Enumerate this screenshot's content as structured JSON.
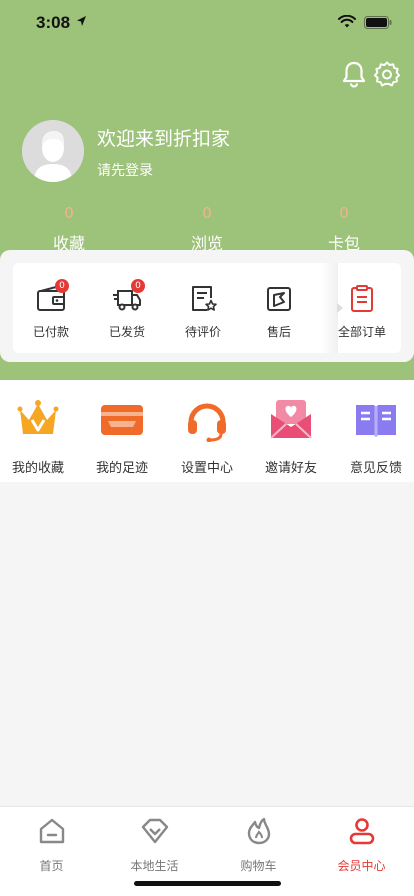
{
  "status": {
    "time": "3:08"
  },
  "profile": {
    "welcome": "欢迎来到折扣家",
    "login": "请先登录"
  },
  "stats": [
    {
      "count": "0",
      "label": "收藏"
    },
    {
      "count": "0",
      "label": "浏览"
    },
    {
      "count": "0",
      "label": "卡包"
    }
  ],
  "orders": {
    "items": [
      {
        "label": "已付款",
        "badge": "0",
        "icon": "wallet-icon"
      },
      {
        "label": "已发货",
        "badge": "0",
        "icon": "truck-icon"
      },
      {
        "label": "待评价",
        "icon": "review-icon"
      },
      {
        "label": "售后",
        "icon": "after-sales-icon"
      }
    ],
    "all": {
      "label": "全部订单",
      "icon": "order-list-icon"
    }
  },
  "services": [
    {
      "label": "我的收藏",
      "icon": "crown-icon",
      "color": "#f5a623"
    },
    {
      "label": "我的足迹",
      "icon": "card-icon",
      "color": "#f06a2a"
    },
    {
      "label": "设置中心",
      "icon": "headset-icon",
      "color": "#f06a2a"
    },
    {
      "label": "邀请好友",
      "icon": "invite-mail-icon",
      "color": "#e94e77"
    },
    {
      "label": "意见反馈",
      "icon": "book-icon",
      "color": "#8b7bf0"
    }
  ],
  "tabbar": {
    "items": [
      {
        "label": "首页",
        "icon": "home-icon"
      },
      {
        "label": "本地生活",
        "icon": "diamond-icon"
      },
      {
        "label": "购物车",
        "icon": "flame-icon"
      },
      {
        "label": "会员中心",
        "icon": "user-icon",
        "active": true
      }
    ]
  },
  "colors": {
    "header": "#9dc27a",
    "accent": "#e53935",
    "count": "#f2b48c"
  }
}
